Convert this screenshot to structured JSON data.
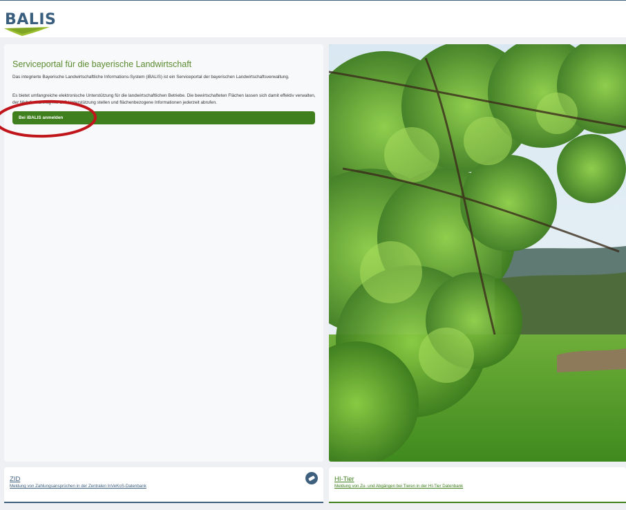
{
  "brand": {
    "logo_text": "BALIS"
  },
  "intro": {
    "title": "Serviceportal für die bayerische Landwirtschaft",
    "paragraph1": "Das integrierte Bayerische Landwirtschaftliche Informations-System (iBALIS) ist ein Serviceportal der bayerischen Landwirtschaftsverwaltung.",
    "paragraph2": "Es bietet umfangreiche elektronische Unterstützung für die landwirtschaftlichen Betriebe. Die bewirtschafteten Flächen lassen sich damit effektiv verwalten, der Mehrfachantrag mit GIS-Unterstützung stellen und flächenbezogene Informationen jederzeit abrufen.",
    "login_label": "Bei iBALIS anmelden"
  },
  "cards": {
    "zid": {
      "title": "ZID",
      "description": "Meldung von Zahlungsansprüchen in der Zentralen InVeKoS-Datenbank",
      "icon": "eraser-icon"
    },
    "hitier": {
      "title": "HI-Tier",
      "description": "Meldung von Zu- und Abgängen bei Tieren in der HI-Tier Datenbank"
    }
  },
  "colors": {
    "primary_blue": "#3e5f7e",
    "primary_green": "#3f7f1d",
    "title_green": "#5a8a2e",
    "annotation_red": "#c0151b"
  }
}
